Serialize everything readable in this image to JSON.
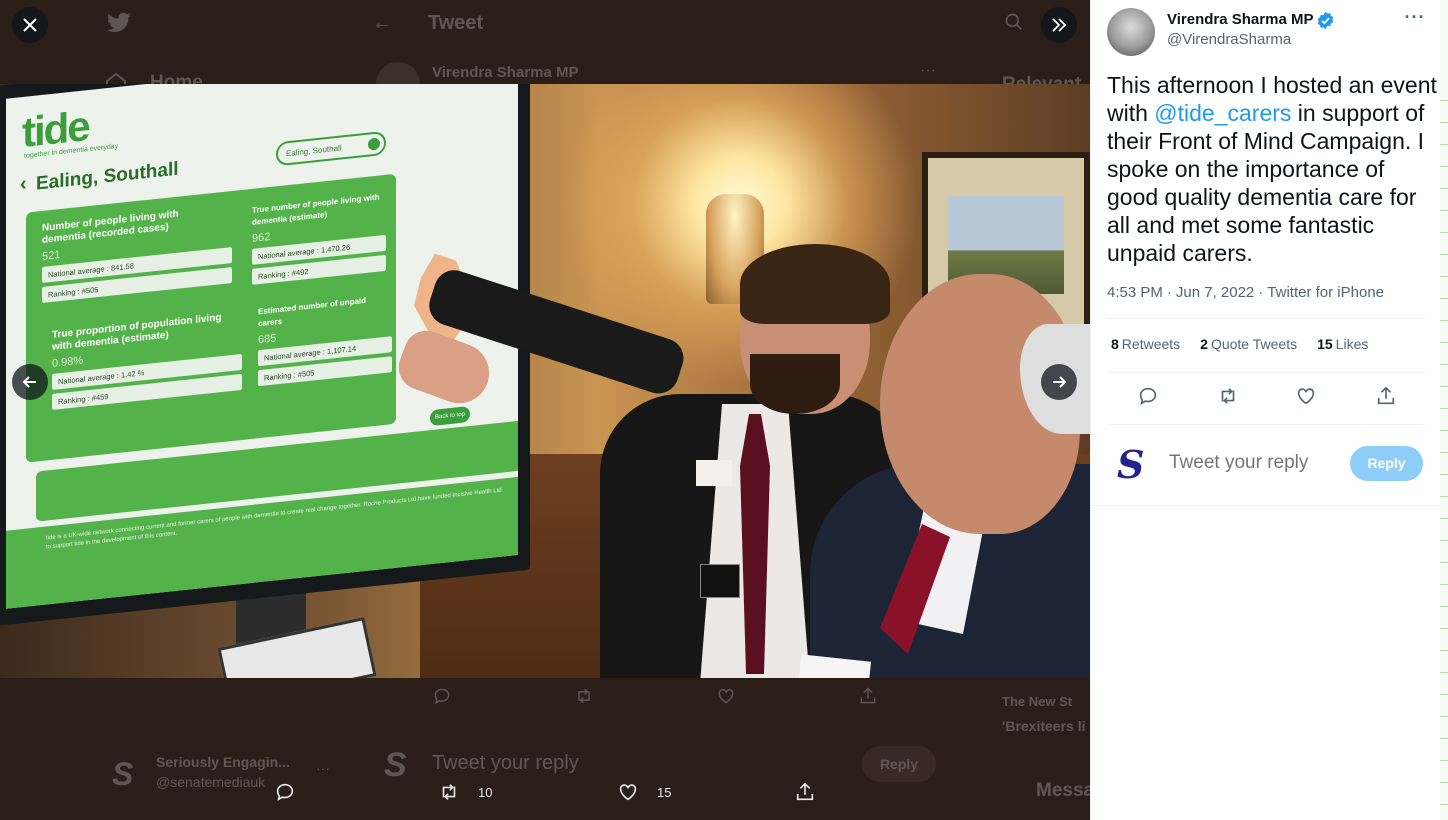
{
  "background": {
    "home_label": "Home",
    "tweet_title": "Tweet",
    "author": "Virendra Sharma MP",
    "reply_user": "Seriously Engagin...",
    "reply_handle": "@senatemediauk",
    "reply_placeholder": "Tweet your reply",
    "reply_button": "Reply",
    "relevant_heading": "Relevant",
    "news_source": "The New St",
    "news_headline": "'Brexiteers li it's impossibl be t",
    "messages_label": "Messa"
  },
  "screen": {
    "logo": "tide",
    "tagline": "together in dementia everyday",
    "region": "Ealing, Southall",
    "search_value": "Ealing, Southall",
    "stats": [
      {
        "label": "Number of people living with dementia (recorded cases)",
        "value": "521",
        "row1": "National average : 841.58",
        "row2": "Ranking : #505"
      },
      {
        "label": "True number of people living with dementia (estimate)",
        "value": "962",
        "row1": "National average : 1,470.26",
        "row2": "Ranking : #492"
      },
      {
        "label": "True proportion of population living with dementia (estimate)",
        "value": "0.98%",
        "row1": "National average : 1.42 %",
        "row2": "Ranking : #459"
      },
      {
        "label": "Estimated number of unpaid carers",
        "value": "685",
        "row1": "National average : 1,107.14",
        "row2": "Ranking : #505"
      }
    ],
    "button": "Back to top",
    "footer": "tide is a UK-wide network connecting current and former carers of people with dementia to create real change together. Roche Products Ltd have funded Incisive Health Ltd to support tide in the development of this content."
  },
  "media_actions": {
    "retweets": "10",
    "likes": "15"
  },
  "tweet": {
    "author_name": "Virendra Sharma MP",
    "author_handle": "@VirendraSharma",
    "text_before": "This afternoon I hosted an event with ",
    "mention": "@tide_carers",
    "text_after": " in support of their Front of Mind Campaign. I spoke on the importance of good quality dementia care for all and met some fantastic unpaid carers.",
    "time": "4:53 PM",
    "date": "Jun 7, 2022",
    "source": "Twitter for iPhone",
    "retweets_count": "8",
    "retweets_label": "Retweets",
    "quotes_count": "2",
    "quotes_label": "Quote Tweets",
    "likes_count": "15",
    "likes_label": "Likes"
  },
  "reply": {
    "placeholder": "Tweet your reply",
    "button": "Reply",
    "logo_letter": "S"
  },
  "colors": {
    "accent": "#1d9bf0",
    "reply_button": "#8ecdf8",
    "screen_green": "#54b24a"
  }
}
